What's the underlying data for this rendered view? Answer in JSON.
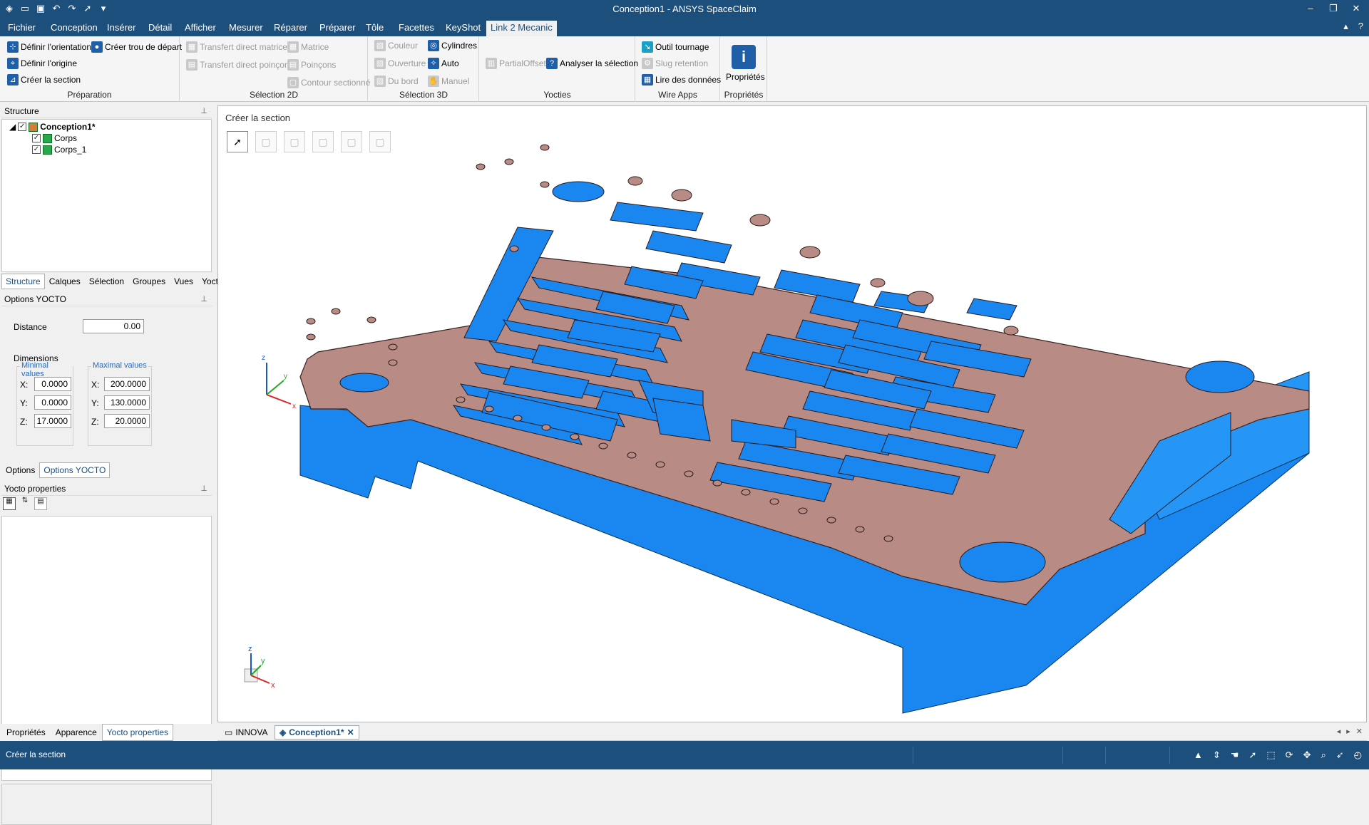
{
  "window": {
    "title": "Conception1 - ANSYS SpaceClaim"
  },
  "quick_access": [
    "app-icon",
    "open-icon",
    "save-icon",
    "undo-icon",
    "redo-icon",
    "select-tool-icon",
    "customize-icon"
  ],
  "menu": {
    "tabs": [
      "Fichier",
      "Conception",
      "Insérer",
      "Détail",
      "Afficher",
      "Mesurer",
      "Réparer",
      "Préparer",
      "Tôle",
      "Facettes",
      "KeyShot",
      "Link 2 Mecanic"
    ],
    "active": "Link 2 Mecanic"
  },
  "ribbon": {
    "preparation": {
      "label": "Préparation",
      "b1": "Définir l'orientation",
      "b2": "Créer trou de départ",
      "b3": "Définir l'origine",
      "b4": "Créer la section"
    },
    "selection2d": {
      "label": "Sélection 2D",
      "b1": "Transfert direct matrice",
      "b2": "Matrice",
      "b3": "Transfert direct poinçon",
      "b4": "Poinçons",
      "b5": "Contour sectionné"
    },
    "selection3d": {
      "label": "Sélection 3D",
      "b1": "Couleur",
      "b2": "Cylindres",
      "b3": "Ouverture",
      "b4": "Auto",
      "b5": "Du bord",
      "b6": "Manuel"
    },
    "yocties": {
      "label": "Yocties",
      "b1": "PartialOffset",
      "b2": "Analyser la sélection"
    },
    "wireapps": {
      "label": "Wire Apps",
      "b1": "Outil tournage",
      "b2": "Slug retention",
      "b3": "Lire des données"
    },
    "proprietes": {
      "label": "Propriétés",
      "b1": "Propriétés"
    }
  },
  "structure": {
    "header": "Structure",
    "root": "Conception1*",
    "children": [
      "Corps",
      "Corps_1"
    ],
    "tabs": [
      "Structure",
      "Calques",
      "Sélection",
      "Groupes",
      "Vues",
      "Yocto"
    ]
  },
  "options": {
    "header": "Options YOCTO",
    "distance_label": "Distance",
    "distance_value": "0.00",
    "dimensions_label": "Dimensions",
    "min_label": "Minimal values",
    "max_label": "Maximal values",
    "min": {
      "x": "0.0000",
      "y": "0.0000",
      "z": "17.0000"
    },
    "max": {
      "x": "200.0000",
      "y": "130.0000",
      "z": "20.0000"
    },
    "tabs": [
      "Options",
      "Options YOCTO"
    ]
  },
  "yocto": {
    "header": "Yocto properties"
  },
  "bottom_tabs": [
    "Propriétés",
    "Apparence",
    "Yocto properties"
  ],
  "viewport": {
    "mode_title": "Créer la section"
  },
  "doc_tabs": [
    "INNOVA",
    "Conception1*"
  ],
  "status": {
    "text": "Créer la section"
  },
  "colors": {
    "body_top": "#b98b85",
    "body_side": "#1a86f0",
    "accent": "#1d4f7d"
  }
}
